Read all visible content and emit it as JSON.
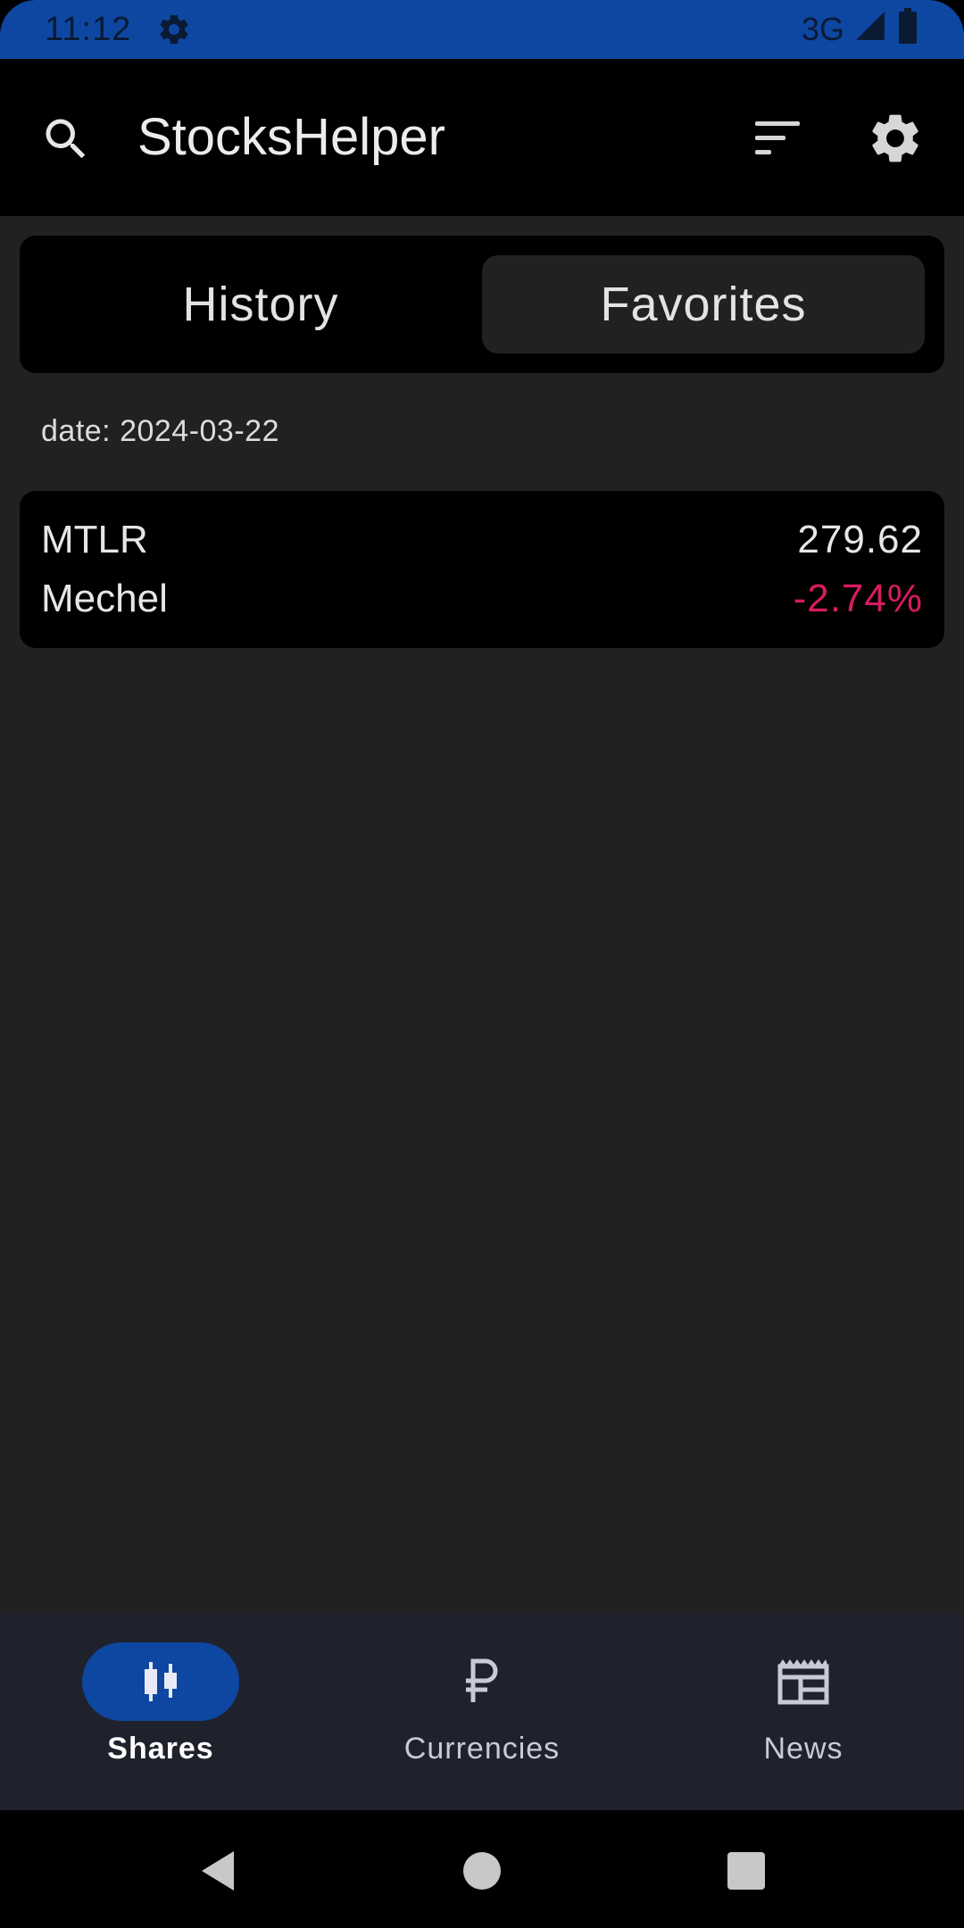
{
  "status_bar": {
    "time": "11:12",
    "network": "3G",
    "icons": [
      "gear-icon",
      "signal-icon",
      "battery-icon"
    ]
  },
  "app_bar": {
    "title": "StocksHelper",
    "icons": [
      "search-icon",
      "sort-icon",
      "settings-icon"
    ]
  },
  "tabs": {
    "history": "History",
    "favorites": "Favorites",
    "selected": "Favorites"
  },
  "date_label": "date: 2024-03-22",
  "stocks": [
    {
      "ticker": "MTLR",
      "name": "Mechel",
      "price": "279.62",
      "change": "-2.74%",
      "change_color": "#d81b60"
    }
  ],
  "bottom_nav": {
    "items": [
      {
        "label": "Shares",
        "icon": "candlestick-icon",
        "selected": true
      },
      {
        "label": "Currencies",
        "icon": "ruble-icon",
        "selected": false
      },
      {
        "label": "News",
        "icon": "newspaper-icon",
        "selected": false
      }
    ]
  },
  "system_nav": {
    "icons": [
      "back-icon",
      "home-icon",
      "recents-icon"
    ]
  },
  "colors": {
    "accent": "#0d47a1",
    "background": "#212121",
    "negative": "#d81b60"
  }
}
